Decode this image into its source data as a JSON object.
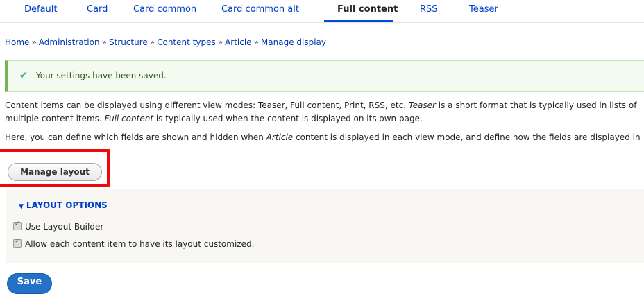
{
  "tabs": [
    "Default",
    "Card",
    "Card common",
    "Card common alt",
    "Full content",
    "RSS",
    "Teaser"
  ],
  "breadcrumb": [
    "Home",
    "Administration",
    "Structure",
    "Content types",
    "Article",
    "Manage display"
  ],
  "breadcrumb_separator": "»",
  "message": {
    "text": "Your settings have been saved.",
    "icon": "checkmark-icon"
  },
  "description": {
    "p1_a": "Content items can be displayed using different view modes: Teaser, Full content, Print, RSS, etc. ",
    "p1_b": "Teaser",
    "p1_c": " is a short format that is typically used in lists of multiple content items. ",
    "p1_d": "Full content",
    "p1_e": " is typically used when the content is displayed on its own page.",
    "p2_a": "Here, you can define which fields are shown and hidden when ",
    "p2_b": "Article",
    "p2_c": " content is displayed in each view mode, and define how the fields are displayed in each view mode."
  },
  "manage_layout_label": "Manage layout",
  "layout_options": {
    "summary": "LAYOUT OPTIONS",
    "use_layout_builder": "Use Layout Builder",
    "allow_custom": "Allow each content item to have its layout customized."
  },
  "save_label": "Save",
  "colors": {
    "link": "#003ecc",
    "active_tab_underline": "#004adc",
    "success_border": "#77b259",
    "primary_button": "#2372c8",
    "highlight": "#ee0a0a"
  }
}
